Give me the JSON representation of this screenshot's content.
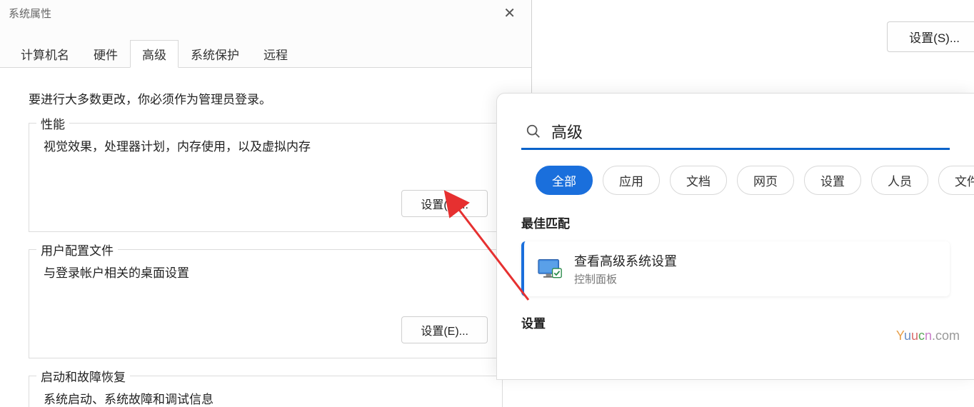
{
  "dialog": {
    "title": "系统属性",
    "tabs": [
      "计算机名",
      "硬件",
      "高级",
      "系统保护",
      "远程"
    ],
    "active_tab_index": 2,
    "admin_note": "要进行大多数更改，你必须作为管理员登录。",
    "groups": [
      {
        "title": "性能",
        "desc": "视觉效果，处理器计划，内存使用，以及虚拟内存",
        "button": "设置(S)..."
      },
      {
        "title": "用户配置文件",
        "desc": "与登录帐户相关的桌面设置",
        "button": "设置(E)..."
      },
      {
        "title": "启动和故障恢复",
        "desc": "系统启动、系统故障和调试信息",
        "button": ""
      }
    ]
  },
  "top_button": "设置(S)...",
  "search": {
    "query": "高级",
    "filters": [
      "全部",
      "应用",
      "文档",
      "网页",
      "设置",
      "人员",
      "文件夹"
    ],
    "active_filter_index": 0,
    "best_match_label": "最佳匹配",
    "result": {
      "title": "查看高级系统设置",
      "subtitle": "控制面板"
    },
    "settings_label": "设置"
  },
  "watermark": {
    "text": "Yuucn.com"
  }
}
